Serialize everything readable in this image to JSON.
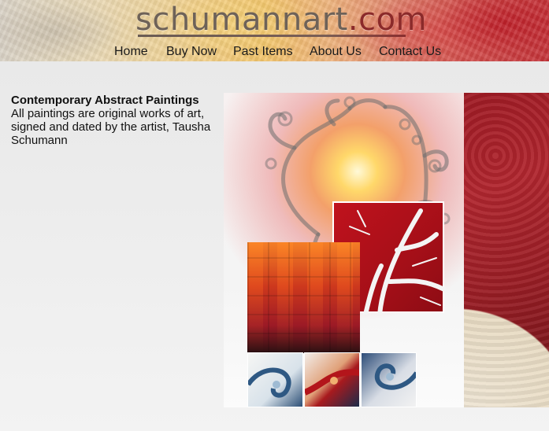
{
  "site": {
    "logo_main": "schumannart",
    "logo_tld": ".com"
  },
  "nav": {
    "items": [
      {
        "label": "Home"
      },
      {
        "label": "Buy Now"
      },
      {
        "label": "Past Items"
      },
      {
        "label": "About Us"
      },
      {
        "label": "Contact Us"
      }
    ]
  },
  "intro": {
    "title": "Contemporary Abstract Paintings",
    "body": "All paintings are original works of art, signed and dated by the artist, Tausha Schumann"
  },
  "colors": {
    "accent_red": "#b1262f",
    "logo_gray": "#6e6258",
    "background": "#e9e9e9"
  },
  "images": {
    "collage": "painting-collage",
    "header": "abstract-painting-banner"
  }
}
